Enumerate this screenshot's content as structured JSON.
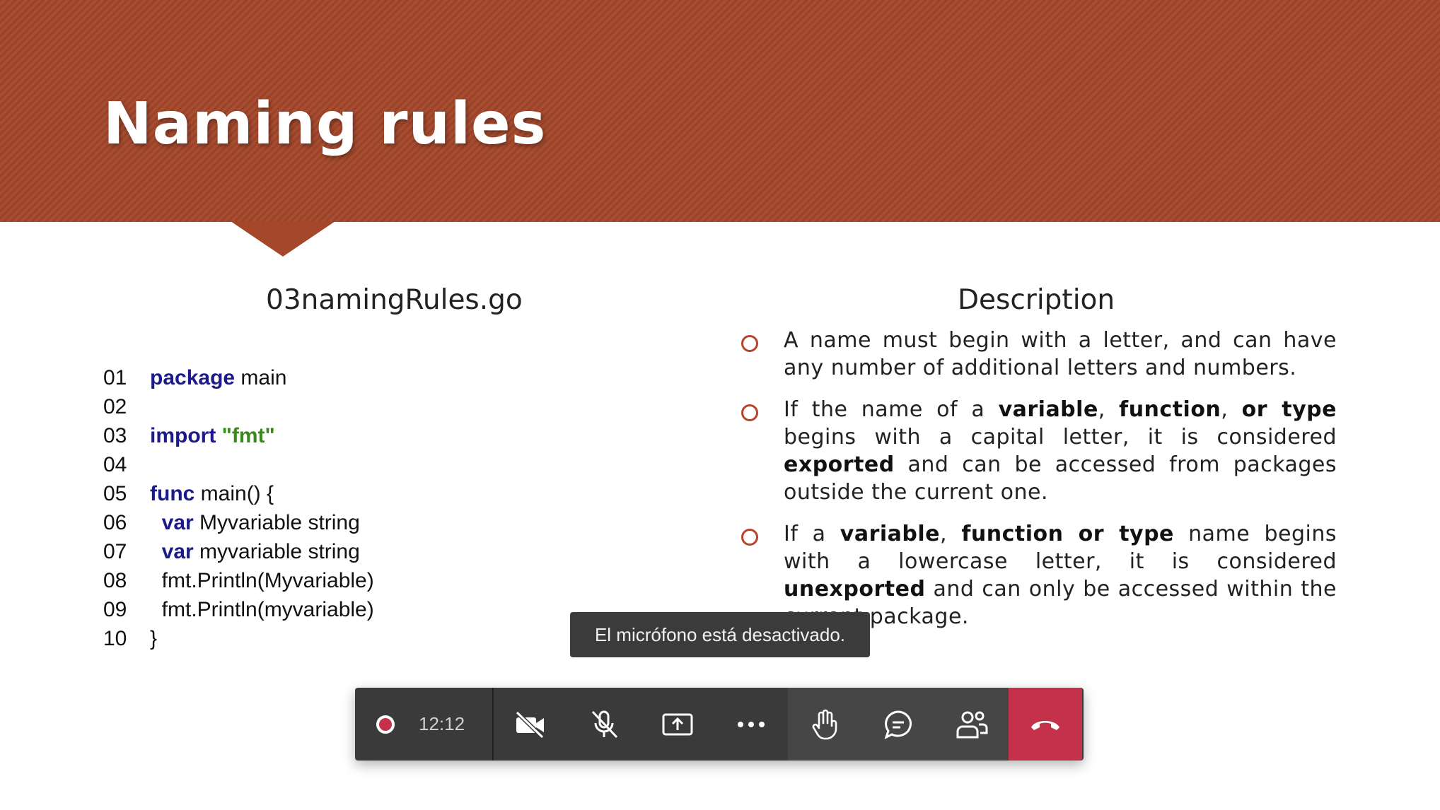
{
  "slide": {
    "title": "Naming rules",
    "code_heading": "03namingRules.go",
    "description_heading": "Description",
    "code_lines": [
      {
        "num": "01",
        "tokens": [
          {
            "t": "package",
            "k": "kw"
          },
          {
            "t": " main",
            "k": ""
          }
        ]
      },
      {
        "num": "02",
        "tokens": []
      },
      {
        "num": "03",
        "tokens": [
          {
            "t": "import",
            "k": "kw"
          },
          {
            "t": " ",
            "k": ""
          },
          {
            "t": "\"fmt\"",
            "k": "str"
          }
        ]
      },
      {
        "num": "04",
        "tokens": []
      },
      {
        "num": "05",
        "tokens": [
          {
            "t": "func",
            "k": "kw"
          },
          {
            "t": " main() {",
            "k": ""
          }
        ]
      },
      {
        "num": "06",
        "tokens": [
          {
            "t": "  ",
            "k": ""
          },
          {
            "t": "var",
            "k": "kw"
          },
          {
            "t": " Myvariable string",
            "k": ""
          }
        ]
      },
      {
        "num": "07",
        "tokens": [
          {
            "t": "  ",
            "k": ""
          },
          {
            "t": "var",
            "k": "kw"
          },
          {
            "t": " myvariable string",
            "k": ""
          }
        ]
      },
      {
        "num": "08",
        "tokens": [
          {
            "t": "  fmt.Println(Myvariable)",
            "k": ""
          }
        ]
      },
      {
        "num": "09",
        "tokens": [
          {
            "t": "  fmt.Println(myvariable)",
            "k": ""
          }
        ]
      },
      {
        "num": "10",
        "tokens": [
          {
            "t": "}",
            "k": ""
          }
        ]
      }
    ],
    "bullets": [
      [
        {
          "t": "A name must begin with a letter, and can have any number of additional letters and numbers.",
          "b": false
        }
      ],
      [
        {
          "t": "If the name of a ",
          "b": false
        },
        {
          "t": "variable",
          "b": true
        },
        {
          "t": ", ",
          "b": false
        },
        {
          "t": "function",
          "b": true
        },
        {
          "t": ", ",
          "b": false
        },
        {
          "t": "or type",
          "b": true
        },
        {
          "t": " begins with a capital letter, it is considered ",
          "b": false
        },
        {
          "t": "exported",
          "b": true
        },
        {
          "t": " and can be accessed from packages outside the current one.",
          "b": false
        }
      ],
      [
        {
          "t": "If a ",
          "b": false
        },
        {
          "t": "variable",
          "b": true
        },
        {
          "t": ", ",
          "b": false
        },
        {
          "t": "function or type",
          "b": true
        },
        {
          "t": " name begins with a lowercase letter, it is considered ",
          "b": false
        },
        {
          "t": "unexported",
          "b": true
        },
        {
          "t": " and can only be accessed within the current package.",
          "b": false
        }
      ]
    ],
    "colors": {
      "banner": "#a4472b",
      "keyword": "#1a1a8c",
      "string": "#3a8a1a",
      "bullet": "#b5442c"
    }
  },
  "toast": {
    "message": "El micrófono está desactivado."
  },
  "call_controls": {
    "recording_indicator": "record-dot",
    "call_time": "12:12",
    "buttons": [
      {
        "name": "camera-off-icon"
      },
      {
        "name": "mic-off-icon"
      },
      {
        "name": "share-screen-icon"
      },
      {
        "name": "more-options-icon"
      },
      {
        "name": "raise-hand-icon"
      },
      {
        "name": "chat-icon"
      },
      {
        "name": "participants-icon"
      },
      {
        "name": "hang-up-icon"
      }
    ],
    "colors": {
      "bar": "#3a3a3a",
      "hangup": "#c4314b",
      "record": "#c4314b"
    }
  }
}
